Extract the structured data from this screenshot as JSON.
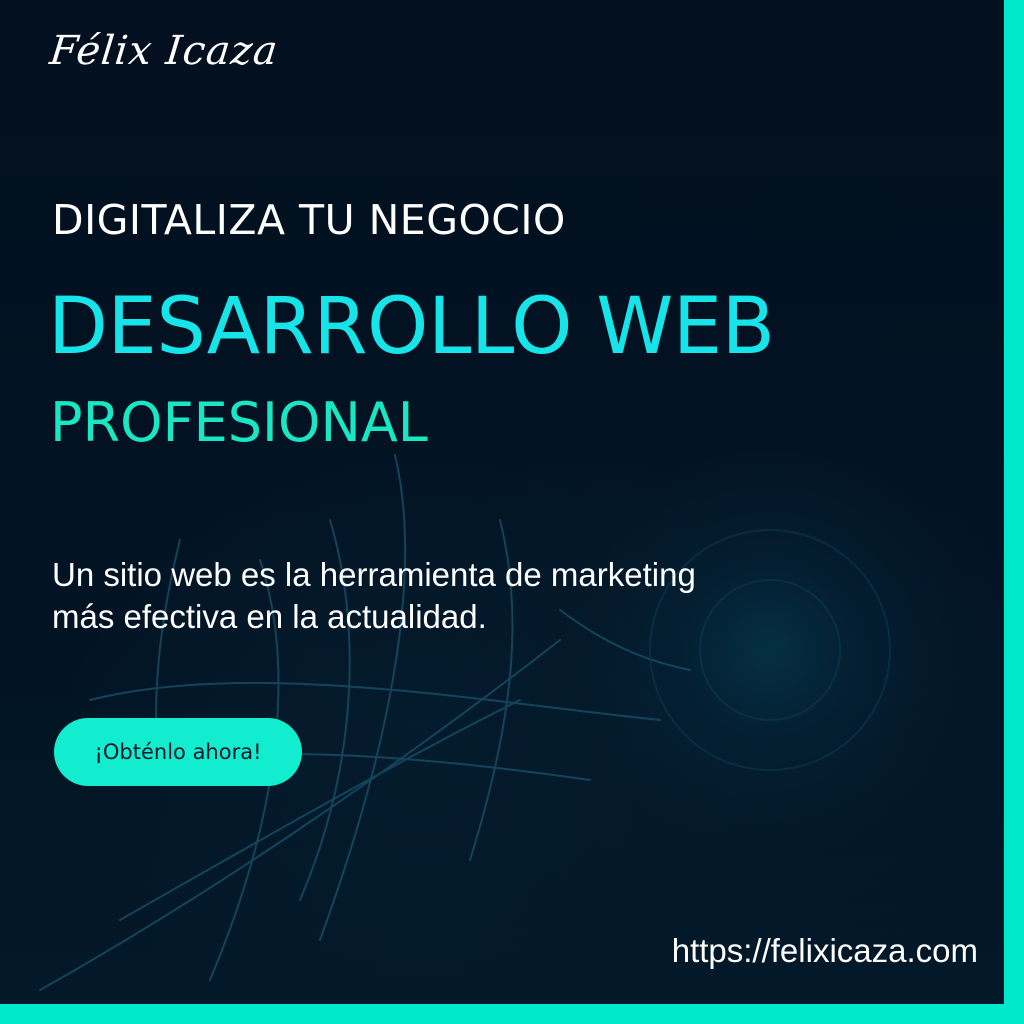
{
  "brand": {
    "logo_text": "Félix Icaza"
  },
  "hero": {
    "kicker": "DIGITALIZA TU NEGOCIO",
    "headline": "DESARROLLO WEB",
    "subheadline": "PROFESIONAL"
  },
  "description": {
    "line1": "Un sitio web es la herramienta de marketing",
    "line2": "más efectiva en la actualidad."
  },
  "cta": {
    "label": "¡Obténlo ahora!"
  },
  "footer": {
    "url": "https://felixicaza.com"
  },
  "colors": {
    "background": "#03101f",
    "accent_frame": "#00e8cc",
    "headline": "#16e4e8",
    "subheadline": "#19e6c2",
    "button": "#12edd0",
    "text": "#ffffff"
  }
}
